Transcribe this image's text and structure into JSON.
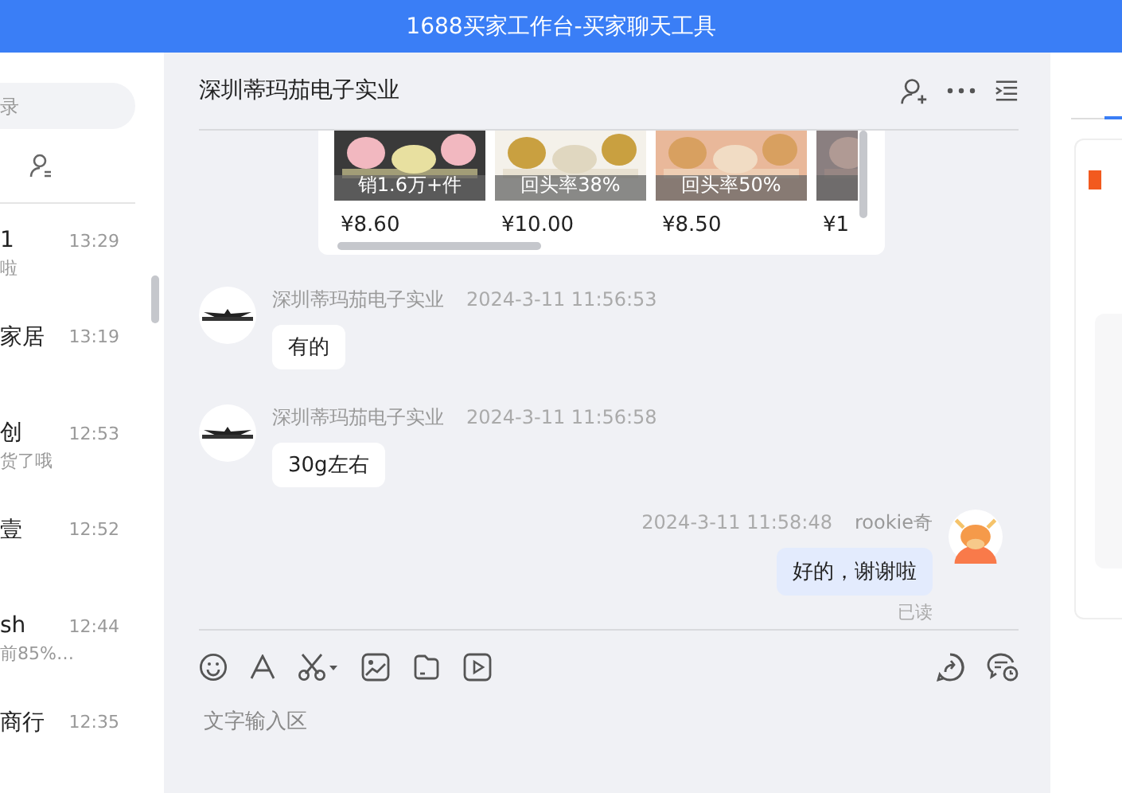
{
  "window": {
    "title": "1688买家工作台-买家聊天工具"
  },
  "sidebar": {
    "search": {
      "placeholder": "录"
    },
    "items": [
      {
        "name": "1",
        "time": "13:29",
        "preview": "啦"
      },
      {
        "name": "家居",
        "time": "13:19"
      },
      {
        "name": "创",
        "time": "12:53",
        "preview": "货了哦"
      },
      {
        "name": "壹",
        "time": "12:52"
      },
      {
        "name": "sh",
        "time": "12:44",
        "preview": "前85%…"
      },
      {
        "name": "商行",
        "time": "12:35"
      }
    ]
  },
  "chat": {
    "title": "深圳蒂玛茄电子实业",
    "products": [
      {
        "caption": "销1.6万+件",
        "price": "¥8.60"
      },
      {
        "caption": "回头率38%",
        "price": "¥10.00"
      },
      {
        "caption": "回头率50%",
        "price": "¥8.50"
      },
      {
        "price": "¥1"
      }
    ],
    "messages": [
      {
        "kind": "incoming",
        "sender": "深圳蒂玛茄电子实业",
        "time": "2024-3-11 11:56:53",
        "text": "有的"
      },
      {
        "kind": "incoming",
        "sender": "深圳蒂玛茄电子实业",
        "time": "2024-3-11 11:56:58",
        "text": "30g左右"
      },
      {
        "kind": "outgoing",
        "sender": "rookie奇",
        "time": "2024-3-11 11:58:48",
        "text": "好的，谢谢啦",
        "receipt": "已读"
      }
    ],
    "input": {
      "placeholder": "文字输入区"
    }
  }
}
